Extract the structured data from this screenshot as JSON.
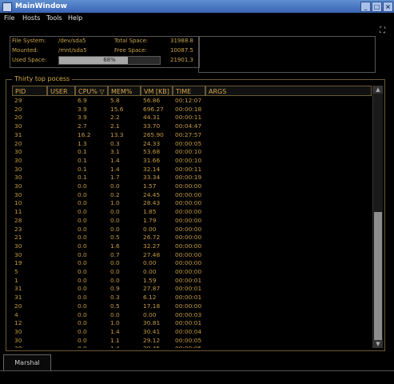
{
  "window": {
    "title": "MainWindow"
  },
  "menu": [
    "File",
    "Hosts",
    "Tools",
    "Help"
  ],
  "fs": {
    "device_label": "File System:",
    "device_value": "/dev/sda5",
    "mounted_label": "Mounted:",
    "mounted_value": "/mnt/sda5",
    "used_label": "Used Space:",
    "used_pct": "68%",
    "used_fraction": 0.68,
    "total_label": "Total Space:",
    "total_value": "31988.8",
    "free_label": "Free Space:",
    "free_value": "10087.5",
    "used_value": "21901.3"
  },
  "process": {
    "legend": "Thirty top pocess",
    "columns": [
      "PID",
      "USER",
      "CPU%",
      "MEM%",
      "VM [KB]",
      "TIME",
      "ARGS"
    ],
    "sort_icon": "sort-down-icon",
    "rows": [
      [
        "29",
        "",
        "6.9",
        "5.8",
        "56.86",
        "00:12:07",
        ""
      ],
      [
        "20",
        "",
        "3.9",
        "15.6",
        "696.27",
        "00:00:18",
        ""
      ],
      [
        "20",
        "",
        "3.9",
        "2.2",
        "44.31",
        "00:00:11",
        ""
      ],
      [
        "30",
        "",
        "2.7",
        "2.1",
        "33.70",
        "00:04:47",
        ""
      ],
      [
        "31",
        "",
        "16.2",
        "13.3",
        "265.90",
        "00:27:57",
        ""
      ],
      [
        "20",
        "",
        "1.3",
        "0.3",
        "24.33",
        "00:00:05",
        ""
      ],
      [
        "30",
        "",
        "0.1",
        "3.1",
        "53.68",
        "00:00:10",
        ""
      ],
      [
        "30",
        "",
        "0.1",
        "1.4",
        "31.66",
        "00:00:10",
        ""
      ],
      [
        "30",
        "",
        "0.1",
        "1.4",
        "32.14",
        "00:00:11",
        ""
      ],
      [
        "30",
        "",
        "0.1",
        "1.7",
        "33.34",
        "00:00:19",
        ""
      ],
      [
        "30",
        "",
        "0.0",
        "0.0",
        "1.57",
        "00:00:00",
        ""
      ],
      [
        "30",
        "",
        "0.0",
        "0.2",
        "24.45",
        "00:00:00",
        ""
      ],
      [
        "10",
        "",
        "0.0",
        "1.0",
        "28.43",
        "00:00:00",
        ""
      ],
      [
        "11",
        "",
        "0.0",
        "0.0",
        "1.85",
        "00:00:00",
        ""
      ],
      [
        "28",
        "",
        "0.0",
        "0.0",
        "1.79",
        "00:00:00",
        ""
      ],
      [
        "23",
        "",
        "0.0",
        "0.0",
        "0.00",
        "00:00:00",
        ""
      ],
      [
        "21",
        "",
        "0.0",
        "0.5",
        "26.72",
        "00:00:00",
        ""
      ],
      [
        "30",
        "",
        "0.0",
        "1.6",
        "32.27",
        "00:00:00",
        ""
      ],
      [
        "30",
        "",
        "0.0",
        "0.7",
        "27.48",
        "00:00:00",
        ""
      ],
      [
        "19",
        "",
        "0.0",
        "0.0",
        "0.00",
        "00:00:00",
        ""
      ],
      [
        "5",
        "",
        "0.0",
        "0.0",
        "0.00",
        "00:00:00",
        ""
      ],
      [
        "1",
        "",
        "0.0",
        "0.0",
        "1.59",
        "00:00:01",
        ""
      ],
      [
        "31",
        "",
        "0.0",
        "0.9",
        "27.87",
        "00:00:01",
        ""
      ],
      [
        "31",
        "",
        "0.0",
        "0.3",
        "6.12",
        "00:00:01",
        ""
      ],
      [
        "20",
        "",
        "0.0",
        "0.5",
        "17.18",
        "00:00:00",
        ""
      ],
      [
        "4",
        "",
        "0.0",
        "0.0",
        "0.00",
        "00:00:03",
        ""
      ],
      [
        "12",
        "",
        "0.0",
        "1.0",
        "30.81",
        "00:00:01",
        ""
      ],
      [
        "30",
        "",
        "0.0",
        "1.4",
        "30.41",
        "00:00:04",
        ""
      ],
      [
        "30",
        "",
        "0.0",
        "1.1",
        "29.12",
        "00:00:05",
        ""
      ],
      [
        "30",
        "",
        "0.0",
        "1.4",
        "29.45",
        "00:00:05",
        ""
      ]
    ]
  },
  "tabs": [
    {
      "label": "Marshal"
    }
  ]
}
